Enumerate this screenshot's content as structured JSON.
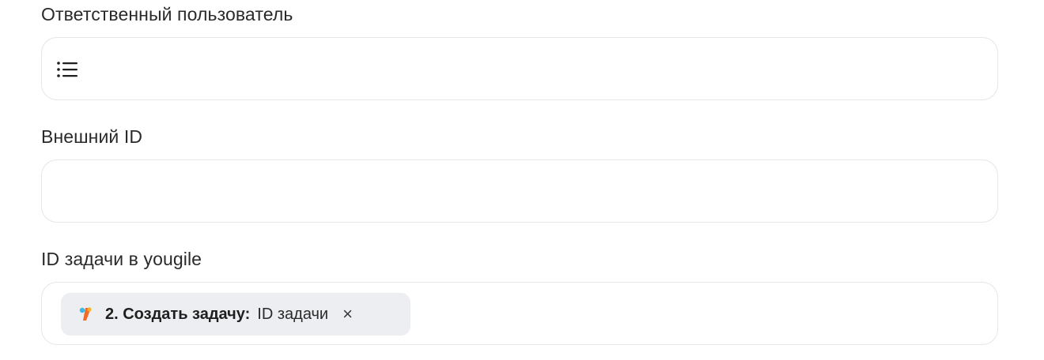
{
  "fields": [
    {
      "label": "Ответственный пользователь",
      "value": "",
      "icon": "list-icon"
    },
    {
      "label": "Внешний ID",
      "value": ""
    },
    {
      "label": "ID задачи в yougile",
      "chip": {
        "step_label": "2. Создать задачу:",
        "value_label": "ID задачи",
        "remove_glyph": "×",
        "app_icon": "yougile-logo-icon"
      }
    }
  ]
}
